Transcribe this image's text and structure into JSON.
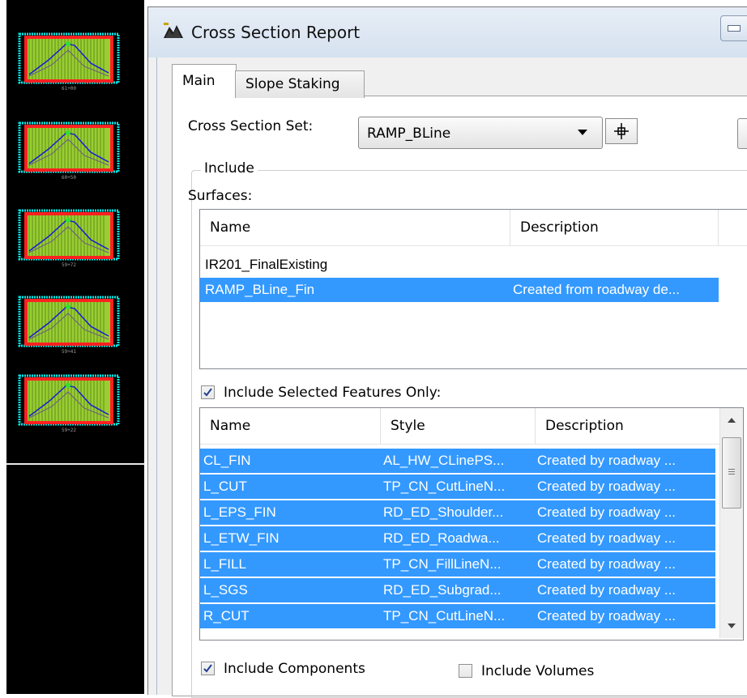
{
  "cad": {
    "sections": [
      {
        "label": "61+00"
      },
      {
        "label": "60+50"
      },
      {
        "label": "59+72"
      },
      {
        "label": "59+41"
      },
      {
        "label": "59+22"
      }
    ]
  },
  "dialog": {
    "title": "Cross Section Report",
    "tabs": [
      {
        "label": "Main",
        "active": true
      },
      {
        "label": "Slope Staking",
        "active": false
      }
    ],
    "cross_section_set": {
      "label": "Cross Section Set:",
      "value": "RAMP_BLine"
    },
    "include_group": {
      "title": "Include",
      "surfaces_label": "Surfaces:",
      "surfaces_columns": [
        "Name",
        "Description"
      ],
      "surfaces": [
        {
          "name": "IR201_FinalExisting",
          "description": "",
          "selected": false
        },
        {
          "name": "RAMP_BLine_Fin",
          "description": "Created from roadway de...",
          "selected": true
        }
      ],
      "selected_features_only": {
        "label": "Include Selected Features Only:",
        "checked": true
      },
      "features_columns": [
        "Name",
        "Style",
        "Description"
      ],
      "features": [
        {
          "name": "CL_FIN",
          "style": "AL_HW_CLinePS...",
          "description": "Created by roadway ..."
        },
        {
          "name": "L_CUT",
          "style": "TP_CN_CutLineN...",
          "description": "Created by roadway ..."
        },
        {
          "name": "L_EPS_FIN",
          "style": "RD_ED_Shoulder...",
          "description": "Created by roadway ..."
        },
        {
          "name": "L_ETW_FIN",
          "style": "RD_ED_Roadwa...",
          "description": "Created by roadway ..."
        },
        {
          "name": "L_FILL",
          "style": "TP_CN_FillLineN...",
          "description": "Created by roadway ..."
        },
        {
          "name": "L_SGS",
          "style": "RD_ED_Subgrad...",
          "description": "Created by roadway ..."
        },
        {
          "name": "R_CUT",
          "style": "TP_CN_CutLineN...",
          "description": "Created by roadway ..."
        }
      ],
      "include_components": {
        "label": "Include Components",
        "checked": true
      },
      "include_volumes": {
        "label": "Include Volumes",
        "checked": false
      }
    }
  },
  "colors": {
    "selection": "#3399ff",
    "cad_background": "#000000",
    "section_frame": "#ff2020",
    "section_fill": "#9acd32",
    "section_ground": "#1a1ad8",
    "section_border": "#00e5e5"
  }
}
